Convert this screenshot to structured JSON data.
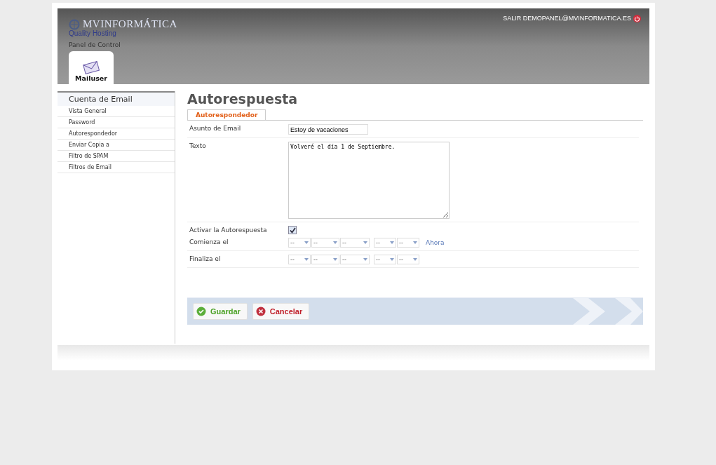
{
  "header": {
    "logo": "MVINFORMÁTICA",
    "tagline": "Quality Hosting",
    "subtitle": "Panel de Control",
    "user_link": "SALIR DEMOPANEL@MVINFORMATICA.ES",
    "tabs": [
      {
        "label": "Mailuser",
        "selected": true
      }
    ]
  },
  "sidebar": {
    "heading": "Cuenta de Email",
    "items": [
      "Vista General",
      "Password",
      "Autorespondedor",
      "Enviar Copia a",
      "Filtro de SPAM",
      "Filtros de Email"
    ]
  },
  "page": {
    "title": "Autorespuesta",
    "tabs": [
      {
        "label": "Autorespondedor",
        "selected": true
      }
    ]
  },
  "form": {
    "subject_label": "Asunto de Email",
    "subject_value": "Estoy de vacaciones",
    "text_label": "Texto",
    "text_value": "Volveré el día 1 de Septiembre.",
    "activate_label": "Activar la Autorespuesta",
    "activate_checked": true,
    "start_label": "Comienza el",
    "start_selects": [
      "--",
      "--",
      "--",
      "--",
      "--"
    ],
    "now_link": "Ahora",
    "end_label": "Finaliza el",
    "end_selects": [
      "--",
      "--",
      "--",
      "--",
      "--"
    ]
  },
  "buttons": [
    {
      "kind": "save",
      "label": "Guardar"
    },
    {
      "kind": "cancel",
      "label": "Cancelar"
    }
  ]
}
